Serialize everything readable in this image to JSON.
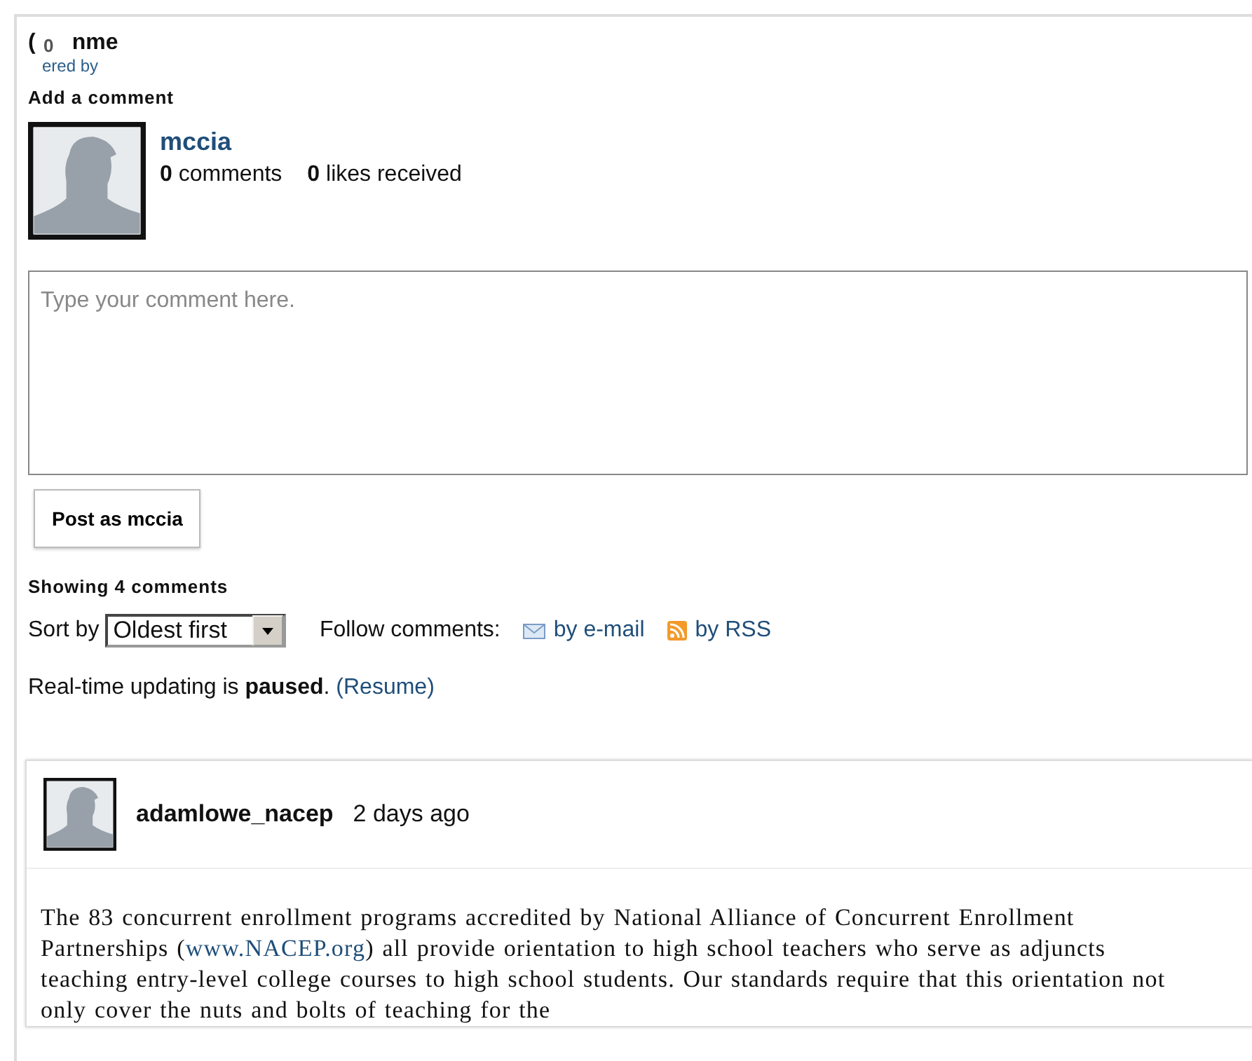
{
  "header": {
    "title_start": "(",
    "title_end": "nme",
    "badge": "0",
    "powered_by": "ered by"
  },
  "add_comment": {
    "heading": "Add a comment",
    "user": "mccia",
    "comments_count": "0",
    "comments_label": "comments",
    "likes_count": "0",
    "likes_label": "likes received"
  },
  "comment_box": {
    "placeholder": "Type your comment here."
  },
  "post_button": "Post as mccia",
  "showing": "Showing 4 comments",
  "sort": {
    "label": "Sort by",
    "value": "Oldest first"
  },
  "follow": {
    "label": "Follow comments:",
    "links": [
      {
        "kind": "email",
        "label": "by e-mail"
      },
      {
        "kind": "rss",
        "label": "by RSS"
      }
    ]
  },
  "realtime": {
    "text": "Real-time updating is **paused**.",
    "link": "(Resume)"
  },
  "comments": [
    {
      "author": "adamlowe_nacep",
      "time": "2 days ago",
      "body_before": "The 83 concurrent enrollment programs accredited by National Alliance of Concurrent Enrollment Partnerships (",
      "link": "www.NACEP.org",
      "body_after": ") all provide orientation to high school teachers who serve as adjuncts teaching entry-level college courses to high school students.  Our standards require that this orientation not only cover the nuts and bolts of teaching for the"
    }
  ]
}
